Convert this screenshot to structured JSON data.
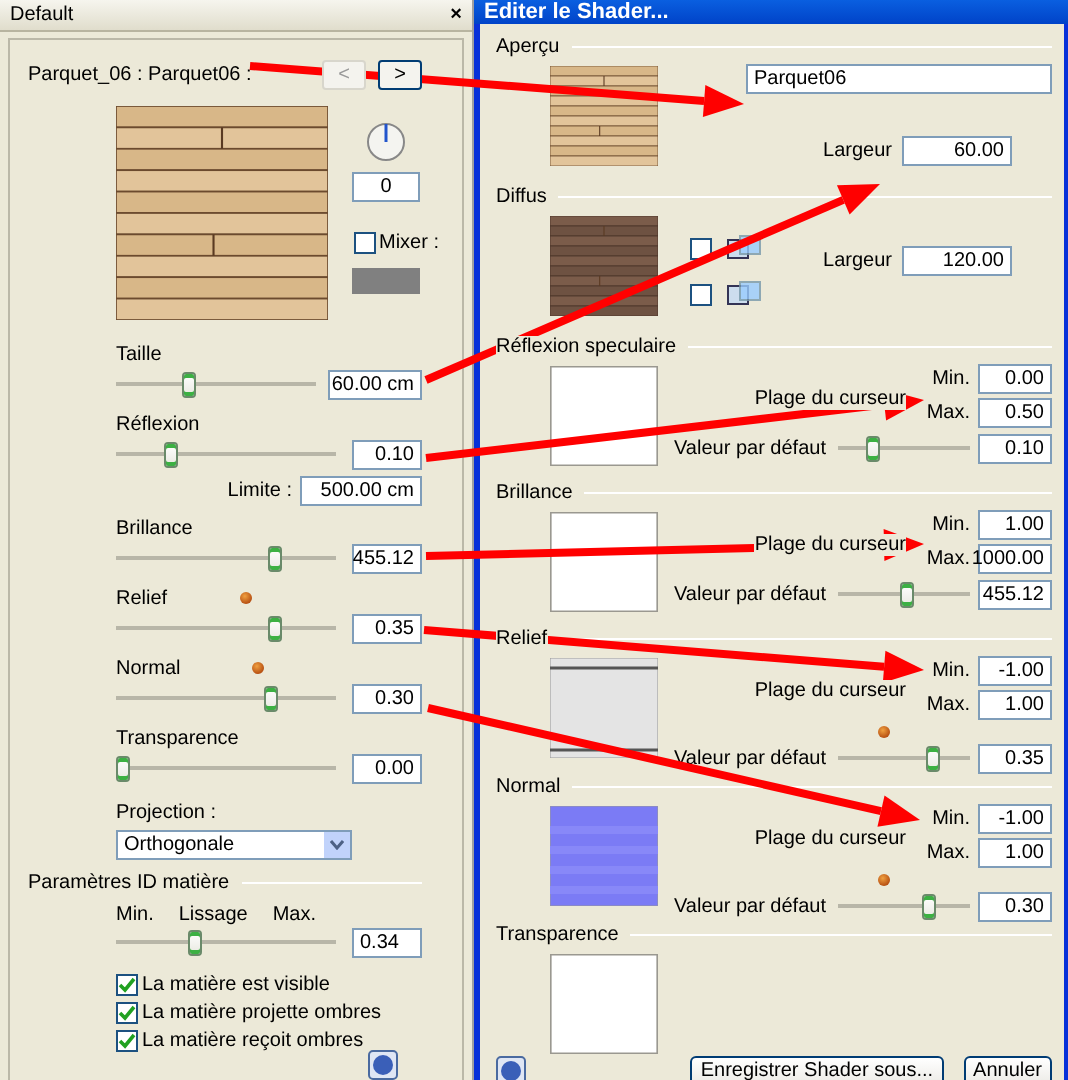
{
  "left": {
    "title": "Default",
    "close": "×",
    "header": "Parquet_06 : Parquet06 :",
    "nav_buttons": [
      "<",
      ">"
    ],
    "rotation_value": "0",
    "mixer": {
      "label": "Mixer :",
      "checked": false
    },
    "sliders": [
      {
        "label": "Taille",
        "level": 0.35,
        "value": "60.00 cm"
      },
      {
        "label": "Réflexion",
        "level": 0.23,
        "value": "0.10",
        "limit": {
          "label": "Limite :",
          "value": "500.00 cm"
        }
      },
      {
        "label": "Brillance",
        "level": 0.74,
        "value": "455.12"
      },
      {
        "label": "Relief",
        "level": 0.74,
        "value": "0.35",
        "indicator": true
      },
      {
        "label": "Normal",
        "level": 0.72,
        "value": "0.30",
        "indicator": true
      },
      {
        "label": "Transparence",
        "level": 0,
        "value": "0.00"
      }
    ],
    "projection": {
      "label": "Projection :",
      "value": "Orthogonale"
    },
    "material_id": {
      "title": "Paramètres ID matière",
      "min_label": "Min.",
      "center_label": "Lissage",
      "max_label": "Max.",
      "level": 0.35,
      "value": "0.34"
    },
    "checkboxes": [
      {
        "label": "La matière est visible",
        "checked": true
      },
      {
        "label": "La matière projette ombres",
        "checked": true
      },
      {
        "label": "La matière reçoit ombres",
        "checked": true
      }
    ]
  },
  "right": {
    "title": "Editer le Shader...",
    "sections": [
      {
        "kind": "preview",
        "title": "Aperçu",
        "name_value": "Parquet06",
        "width_label": "Largeur",
        "width_value": "60.00"
      },
      {
        "kind": "diffuse",
        "title": "Diffus",
        "options": [
          {
            "checked": false
          },
          {
            "checked": false
          }
        ],
        "width_label": "Largeur",
        "width_value": "120.00"
      },
      {
        "kind": "range",
        "title": "Réflexion speculaire",
        "range_label": "Plage du curseur",
        "min_label": "Min.",
        "min": "0.00",
        "max_label": "Max.",
        "max": "0.50",
        "default_label": "Valeur par défaut",
        "level": 0.23,
        "default": "0.10"
      },
      {
        "kind": "range",
        "title": "Brillance",
        "range_label": "Plage du curseur",
        "min_label": "Min.",
        "min": "1.00",
        "max_label": "Max.",
        "max": "1000.00",
        "default_label": "Valeur par défaut",
        "level": 0.5,
        "default": "455.12"
      },
      {
        "kind": "range",
        "title": "Relief",
        "range_label": "Plage du curseur",
        "min_label": "Min.",
        "min": "-1.00",
        "max_label": "Max.",
        "max": "1.00",
        "default_label": "Valeur par défaut",
        "level": 0.7,
        "default": "0.35",
        "indicator": true
      },
      {
        "kind": "range",
        "title": "Normal",
        "range_label": "Plage du curseur",
        "min_label": "Min.",
        "min": "-1.00",
        "max_label": "Max.",
        "max": "1.00",
        "default_label": "Valeur par défaut",
        "level": 0.67,
        "default": "0.30",
        "indicator": true
      },
      {
        "kind": "empty",
        "title": "Transparence"
      }
    ],
    "buttons": [
      "Enregistrer Shader sous...",
      "Annuler"
    ]
  }
}
